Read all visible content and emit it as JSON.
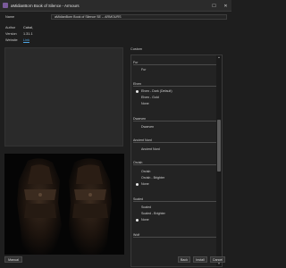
{
  "window": {
    "title": "aMidianBorn Book of Silence - Armours"
  },
  "fields": {
    "name_label": "Name",
    "name_value": "aMidianBorn Book of Silence SE -- ARMOURS",
    "author_label": "Author",
    "author_value": "Cabal,",
    "version_label": "Version",
    "version_value": "1.31.1",
    "website_label": "Website",
    "website_value": "Link"
  },
  "custom": {
    "label": "Custom",
    "groups": [
      {
        "header": "Fur",
        "options": [
          {
            "label": "Fur",
            "selected": false
          }
        ]
      },
      {
        "header": "Elven",
        "options": [
          {
            "label": "Elven - Dark (Default)",
            "selected": true
          },
          {
            "label": "Elven - Gold",
            "selected": false
          },
          {
            "label": "None",
            "selected": false
          }
        ]
      },
      {
        "header": "Dwarven",
        "options": [
          {
            "label": "Dwarven",
            "selected": false
          }
        ]
      },
      {
        "header": "Ancient Nord",
        "options": [
          {
            "label": "Ancient Nord",
            "selected": false
          }
        ]
      },
      {
        "header": "Orcish",
        "options": [
          {
            "label": "Orcish",
            "selected": false
          },
          {
            "label": "Orcish - Brighter",
            "selected": false
          },
          {
            "label": "None",
            "selected": true
          }
        ]
      },
      {
        "header": "Scaled",
        "options": [
          {
            "label": "Scaled",
            "selected": false
          },
          {
            "label": "Scaled - Brighter",
            "selected": false
          },
          {
            "label": "None",
            "selected": true
          }
        ]
      },
      {
        "header": "Wolf",
        "options": []
      }
    ]
  },
  "buttons": {
    "manual": "Manual",
    "back": "Back",
    "install": "Install",
    "cancel": "Cancel"
  }
}
